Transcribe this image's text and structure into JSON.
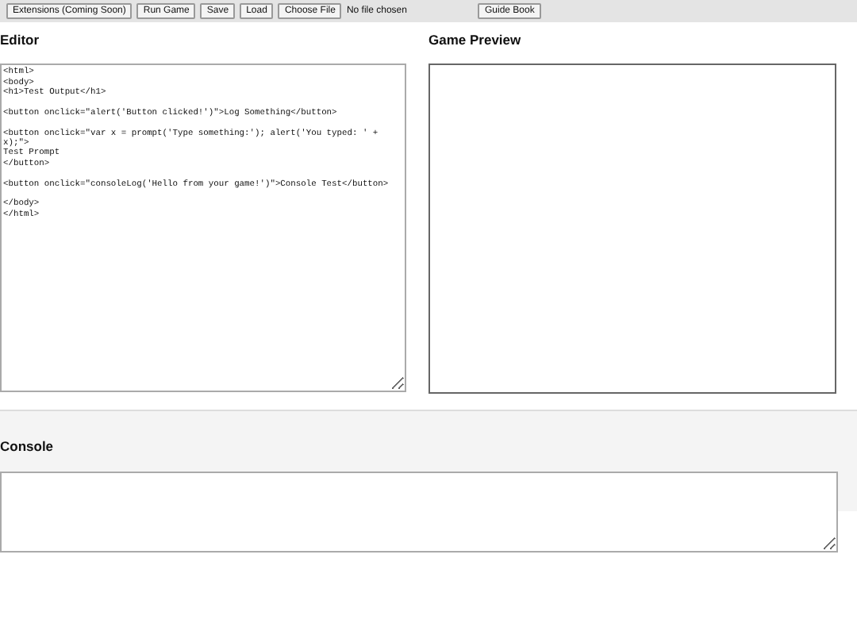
{
  "toolbar": {
    "buttons": [
      "Extensions (Coming Soon)",
      "Run Game",
      "Save",
      "Load"
    ],
    "file_button": "Choose File",
    "file_status": "No file chosen",
    "guide_button": "Guide Book"
  },
  "editor": {
    "title": "Editor",
    "code": "<html>\n<body>\n<h1>Test Output</h1>\n\n<button onclick=\"alert('Button clicked!')\">Log Something</button>\n\n<button onclick=\"var x = prompt('Type something:'); alert('You typed: ' + x);\">\nTest Prompt\n</button>\n\n<button onclick=\"consoleLog('Hello from your game!')\">Console Test</button>\n\n</body>\n</html>"
  },
  "preview": {
    "title": "Game Preview"
  },
  "console": {
    "title": "Console"
  }
}
